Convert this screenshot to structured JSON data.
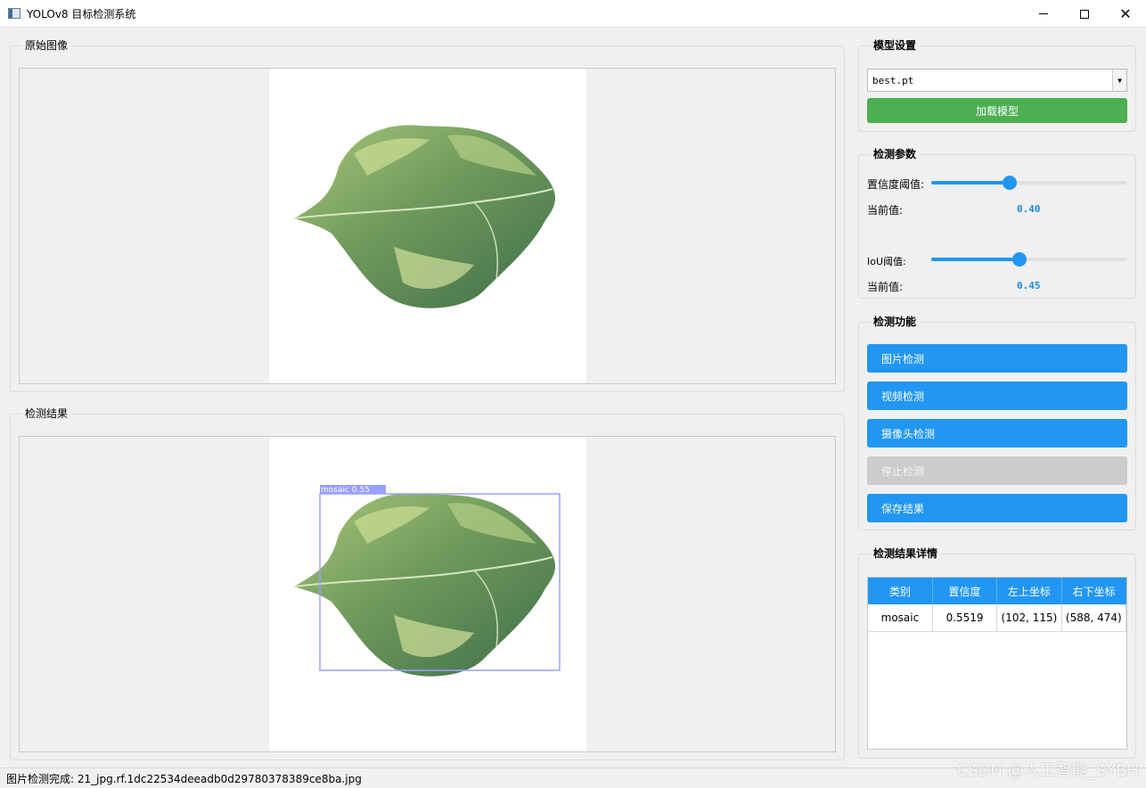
{
  "window": {
    "title": "YOLOv8 目标检测系统",
    "minimize": "–",
    "maximize": "□",
    "close": "✕"
  },
  "groups": {
    "original": "原始图像",
    "result": "检测结果",
    "model": "模型设置",
    "params": "检测参数",
    "functions": "检测功能",
    "details": "检测结果详情"
  },
  "model": {
    "selected": "best.pt",
    "load_button": "加载模型"
  },
  "params": {
    "confidence_label": "置信度阈值:",
    "confidence_current_label": "当前值:",
    "confidence_value": "0.40",
    "confidence_fraction": 0.4,
    "iou_label": "IoU阈值:",
    "iou_current_label": "当前值:",
    "iou_value": "0.45",
    "iou_fraction": 0.45
  },
  "functions": {
    "image_detect": "图片检测",
    "video_detect": "视频检测",
    "camera_detect": "摄像头检测",
    "stop_detect": "停止检测",
    "save_result": "保存结果"
  },
  "detection": {
    "box_label": "mosaic  0.55"
  },
  "table": {
    "headers": [
      "类别",
      "置信度",
      "左上坐标",
      "右下坐标"
    ],
    "rows": [
      [
        "mosaic",
        "0.5519",
        "(102, 115)",
        "(588, 474)"
      ]
    ]
  },
  "status": "图片检测完成: 21_jpg.rf.1dc22534deeadb0d29780378389ce8ba.jpg",
  "watermark": "CSDN @人工智能_SYBH",
  "colors": {
    "accent": "#2196f3",
    "load": "#4caf50",
    "disabled": "#cccccc",
    "box": "#9aa0ff"
  }
}
